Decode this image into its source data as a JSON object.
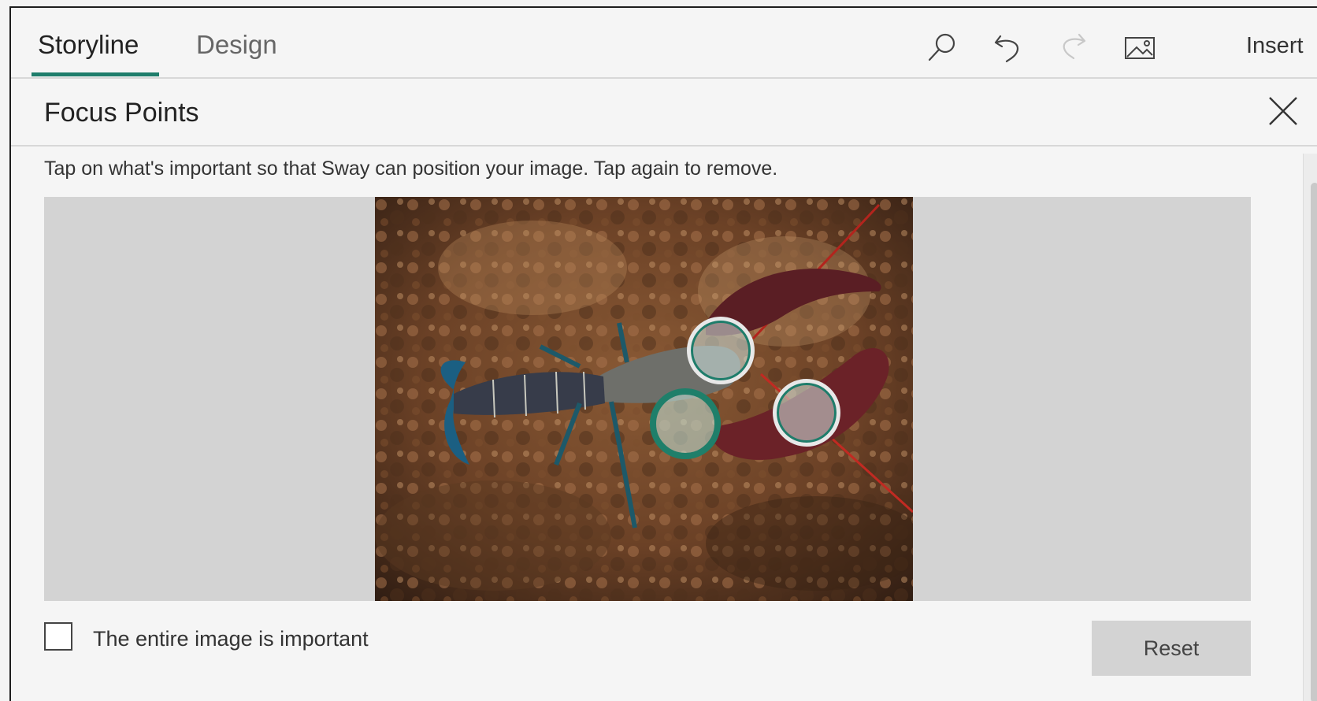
{
  "header": {
    "tabs": [
      {
        "label": "Storyline",
        "active": true
      },
      {
        "label": "Design",
        "active": false
      }
    ],
    "toolbar": {
      "search_icon": "search-icon",
      "undo_icon": "undo-icon",
      "redo_icon": "redo-icon",
      "insert_label": "Insert"
    }
  },
  "panel": {
    "title": "Focus Points",
    "instruction": "Tap on what's important so that Sway can position your image. Tap again to remove.",
    "entire_image_label": "The entire image is important",
    "entire_image_checked": false,
    "reset_label": "Reset",
    "focus_point_count": 3
  },
  "colors": {
    "accent": "#1e7d6b",
    "image_background": "#d3d3d3",
    "panel_background": "#f5f5f5"
  }
}
